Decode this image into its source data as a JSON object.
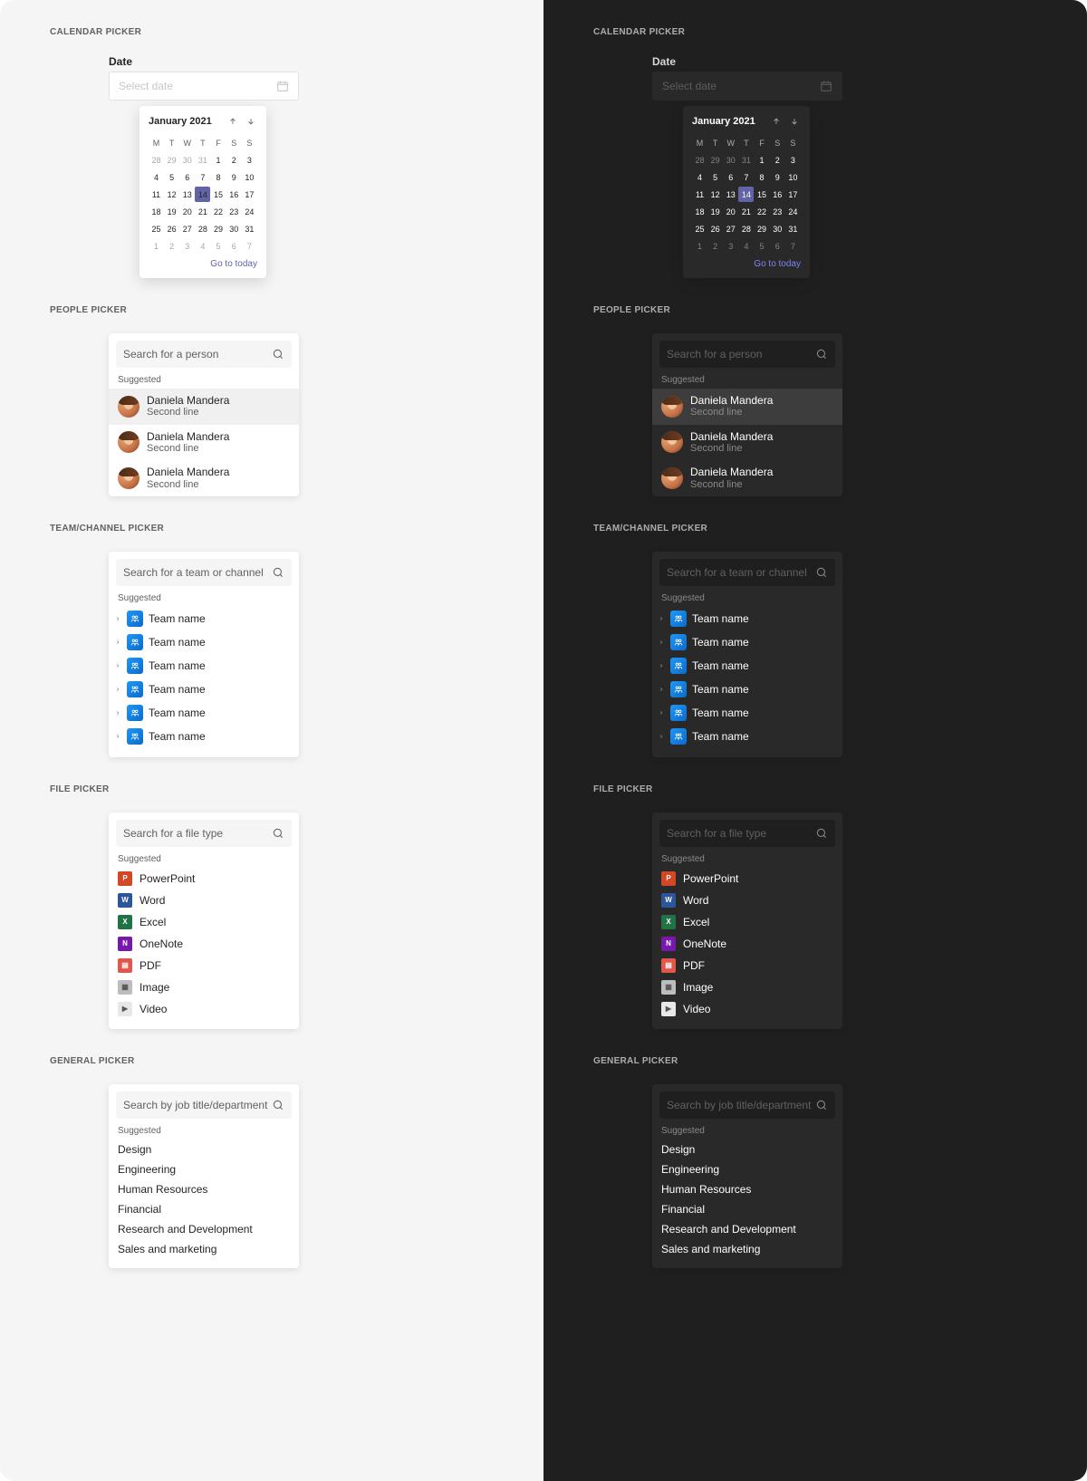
{
  "sections": {
    "calendar": "CALENDAR PICKER",
    "people": "PEOPLE PICKER",
    "team": "TEAM/CHANNEL PICKER",
    "file": "FILE PICKER",
    "general": "GENERAL PICKER"
  },
  "datepicker": {
    "field_label": "Date",
    "placeholder": "Select date",
    "month_year": "January 2021",
    "go_to_today": "Go to today",
    "weekdays": [
      "M",
      "T",
      "W",
      "T",
      "F",
      "S",
      "S"
    ],
    "days": [
      {
        "n": 28,
        "other": true
      },
      {
        "n": 29,
        "other": true
      },
      {
        "n": 30,
        "other": true
      },
      {
        "n": 31,
        "other": true
      },
      {
        "n": 1
      },
      {
        "n": 2
      },
      {
        "n": 3
      },
      {
        "n": 4
      },
      {
        "n": 5
      },
      {
        "n": 6
      },
      {
        "n": 7
      },
      {
        "n": 8
      },
      {
        "n": 9
      },
      {
        "n": 10
      },
      {
        "n": 11
      },
      {
        "n": 12
      },
      {
        "n": 13
      },
      {
        "n": 14,
        "selected": true
      },
      {
        "n": 15
      },
      {
        "n": 16
      },
      {
        "n": 17
      },
      {
        "n": 18
      },
      {
        "n": 19
      },
      {
        "n": 20
      },
      {
        "n": 21
      },
      {
        "n": 22
      },
      {
        "n": 23
      },
      {
        "n": 24
      },
      {
        "n": 25
      },
      {
        "n": 26
      },
      {
        "n": 27
      },
      {
        "n": 28
      },
      {
        "n": 29
      },
      {
        "n": 30
      },
      {
        "n": 31
      },
      {
        "n": 1,
        "other": true
      },
      {
        "n": 2,
        "other": true
      },
      {
        "n": 3,
        "other": true
      },
      {
        "n": 4,
        "other": true
      },
      {
        "n": 5,
        "other": true
      },
      {
        "n": 6,
        "other": true
      },
      {
        "n": 7,
        "other": true
      }
    ]
  },
  "people": {
    "search_placeholder": "Search for a person",
    "suggested_label": "Suggested",
    "items": [
      {
        "name": "Daniela Mandera",
        "sub": "Second line",
        "highlight": true
      },
      {
        "name": "Daniela Mandera",
        "sub": "Second line"
      },
      {
        "name": "Daniela Mandera",
        "sub": "Second line"
      }
    ]
  },
  "team": {
    "search_placeholder": "Search for a team or channel",
    "suggested_label": "Suggested",
    "items": [
      {
        "name": "Team name"
      },
      {
        "name": "Team name"
      },
      {
        "name": "Team name"
      },
      {
        "name": "Team name"
      },
      {
        "name": "Team name"
      },
      {
        "name": "Team name"
      }
    ]
  },
  "file": {
    "search_placeholder": "Search for a file type",
    "suggested_label": "Suggested",
    "items": [
      {
        "name": "PowerPoint",
        "color": "#d24726",
        "ic": "P"
      },
      {
        "name": "Word",
        "color": "#2b579a",
        "ic": "W"
      },
      {
        "name": "Excel",
        "color": "#217346",
        "ic": "X"
      },
      {
        "name": "OneNote",
        "color": "#7719aa",
        "ic": "N"
      },
      {
        "name": "PDF",
        "color": "#e2574c",
        "ic": "▤"
      },
      {
        "name": "Image",
        "color": "#bdbdbd",
        "ic": "▦"
      },
      {
        "name": "Video",
        "color": "#e8e8e8",
        "ic": "▶"
      }
    ]
  },
  "general": {
    "search_placeholder": "Search by job title/department",
    "suggested_label": "Suggested",
    "items": [
      "Design",
      "Engineering",
      "Human Resources",
      "Financial",
      "Research and Development",
      "Sales and marketing"
    ]
  }
}
